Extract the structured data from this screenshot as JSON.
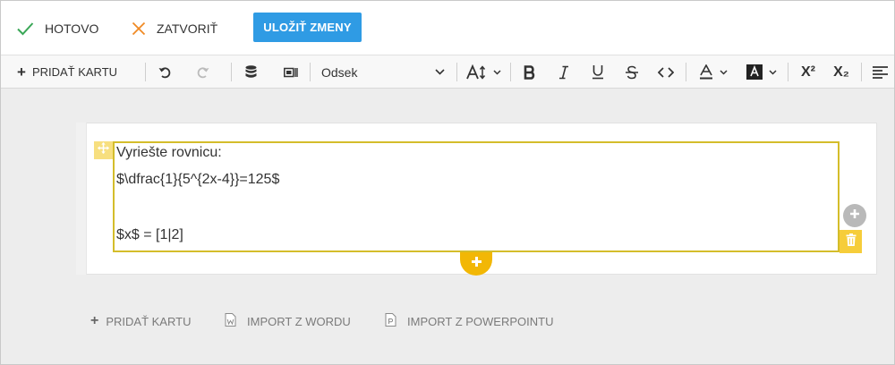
{
  "actions": {
    "done_label": "HOTOVO",
    "close_label": "ZATVORIŤ",
    "save_label": "ULOŽIŤ ZMENY"
  },
  "toolbar": {
    "add_card_label": "PRIDAŤ KARTU",
    "block_format": "Odsek",
    "superscript_label": "X²",
    "subscript_label": "X₂"
  },
  "editor": {
    "lines": [
      "Vyriešte rovnicu:",
      "$\\dfrac{1}{5^{2x-4}}=125$",
      "",
      "$x$ = [1|2]"
    ]
  },
  "footer": {
    "add_card_label": "PRIDAŤ KARTU",
    "import_word_label": "IMPORT Z WORDU",
    "import_ppt_label": "IMPORT Z POWERPOINTU"
  },
  "colors": {
    "accent_blue": "#2f9be4",
    "done_green": "#3aa757",
    "close_orange": "#f08a24",
    "selection_border": "#d4bd2b",
    "add_button_yellow": "#f2b705"
  },
  "icons": [
    "check-icon",
    "x-icon",
    "undo-icon",
    "redo-icon",
    "database-icon",
    "embed-icon",
    "font-size-icon",
    "bold-icon",
    "italic-icon",
    "underline-icon",
    "strikethrough-icon",
    "code-icon",
    "text-color-icon",
    "highlight-icon",
    "superscript-icon",
    "subscript-icon",
    "align-left-icon",
    "move-icon",
    "plus-icon",
    "trash-icon",
    "word-file-icon",
    "powerpoint-file-icon"
  ]
}
